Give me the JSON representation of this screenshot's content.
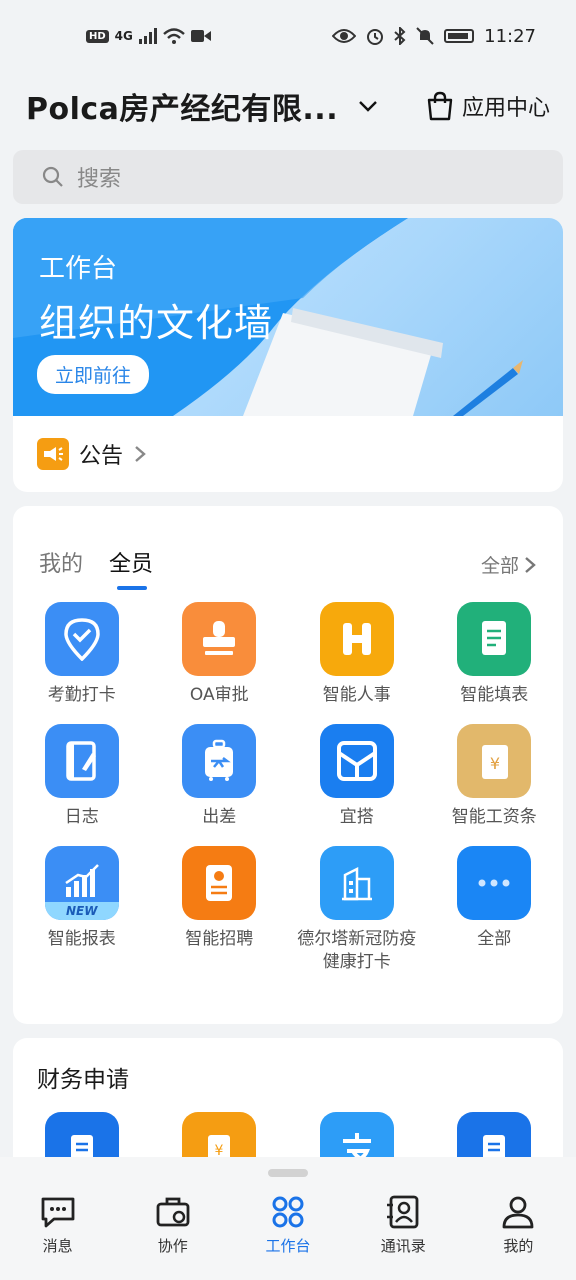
{
  "status_bar": {
    "badge": "HD",
    "network": "4G",
    "time": "11:27"
  },
  "header": {
    "org_name": "Polca房产经纪有限...",
    "app_center_label": "应用中心"
  },
  "search": {
    "placeholder": "搜索"
  },
  "banner": {
    "small_title": "工作台",
    "title": "组织的文化墙",
    "button_label": "立即前往"
  },
  "notice": {
    "label": "公告"
  },
  "apps_card": {
    "tabs": [
      {
        "label": "我的"
      },
      {
        "label": "全员"
      }
    ],
    "all_label": "全部",
    "apps": [
      {
        "label": "考勤打卡",
        "icon": "location-check-icon",
        "color": "#3b8ef5"
      },
      {
        "label": "OA审批",
        "icon": "stamp-icon",
        "color": "#f98d3b"
      },
      {
        "label": "智能人事",
        "icon": "h-letter-icon",
        "color": "#f7a90c"
      },
      {
        "label": "智能填表",
        "icon": "form-icon",
        "color": "#21b07a"
      },
      {
        "label": "日志",
        "icon": "journal-icon",
        "color": "#3b8ef5"
      },
      {
        "label": "出差",
        "icon": "luggage-icon",
        "color": "#3b8ef5"
      },
      {
        "label": "宜搭",
        "icon": "yida-icon",
        "color": "#1a7ef0"
      },
      {
        "label": "智能工资条",
        "icon": "payslip-icon",
        "color": "#e2b86b"
      },
      {
        "label": "智能报表",
        "icon": "chart-icon",
        "color": "#3b8ef5",
        "badge": "NEW"
      },
      {
        "label": "智能招聘",
        "icon": "resume-icon",
        "color": "#f57c13"
      },
      {
        "label": "德尔塔新冠防疫健康打卡",
        "icon": "building-icon",
        "color": "#2d9df7"
      },
      {
        "label": "全部",
        "icon": "more-icon",
        "color": "#1a86f5"
      }
    ]
  },
  "finance": {
    "title": "财务申请",
    "apps": [
      {
        "icon": "document-icon",
        "color": "#1a73e8"
      },
      {
        "icon": "yuan-scroll-icon",
        "color": "#f59d12"
      },
      {
        "icon": "alipay-icon",
        "color": "#2d9df7"
      },
      {
        "icon": "document-icon",
        "color": "#1a73e8"
      }
    ]
  },
  "navbar": {
    "items": [
      {
        "label": "消息"
      },
      {
        "label": "协作"
      },
      {
        "label": "工作台"
      },
      {
        "label": "通讯录"
      },
      {
        "label": "我的"
      }
    ],
    "active_color": "#1a73e8"
  }
}
